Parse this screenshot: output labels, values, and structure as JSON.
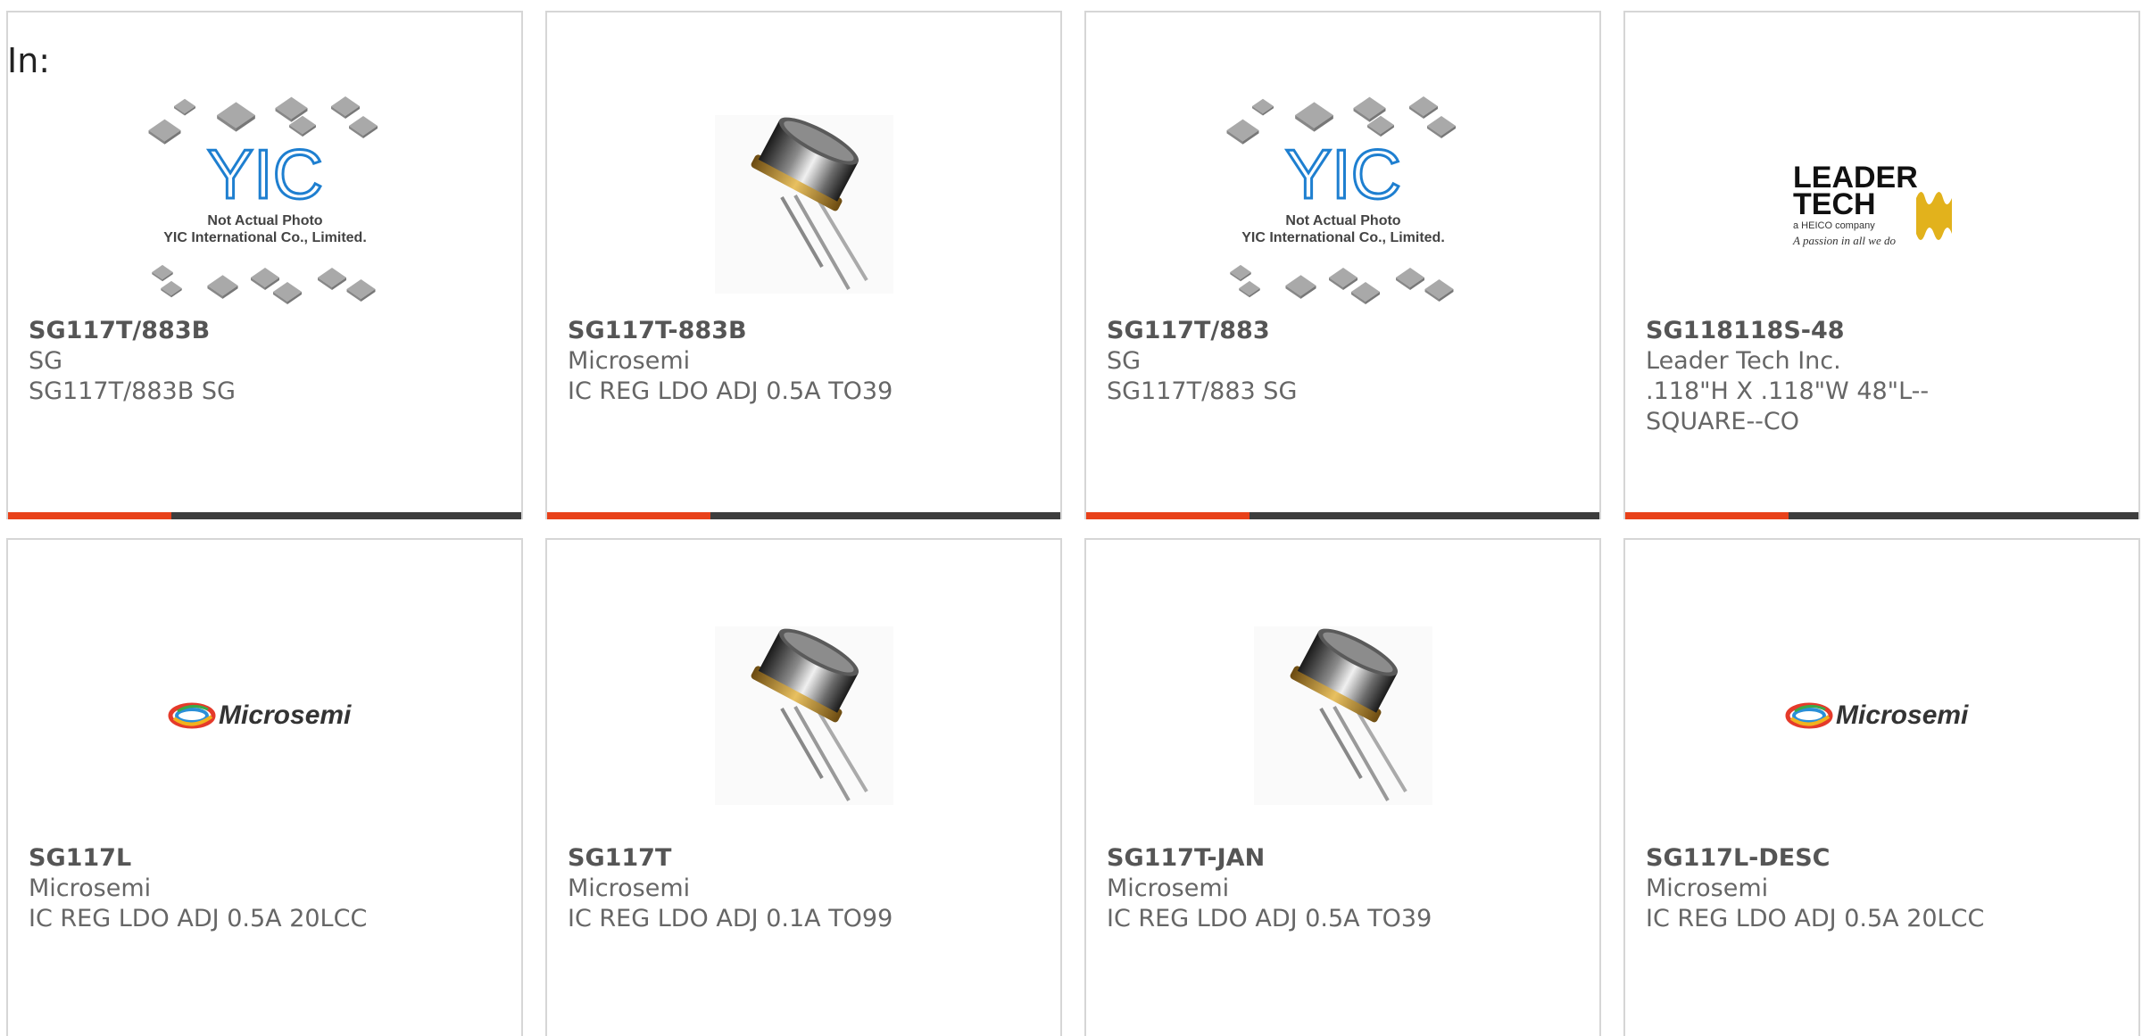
{
  "filter": {
    "label": "In:"
  },
  "products": [
    {
      "part": "SG117T/883B",
      "manufacturer": "SG",
      "description": "SG117T/883B SG",
      "image": "yic-placeholder-photo",
      "placeholder_caption": [
        "Not Actual Photo",
        "YIC International Co., Limited."
      ]
    },
    {
      "part": "SG117T-883B",
      "manufacturer": "Microsemi",
      "description": "IC REG LDO ADJ 0.5A TO39",
      "image": "to-can-transistor-photo"
    },
    {
      "part": "SG117T/883",
      "manufacturer": "SG",
      "description": "SG117T/883 SG",
      "image": "yic-placeholder-photo",
      "placeholder_caption": [
        "Not Actual Photo",
        "YIC International Co., Limited."
      ]
    },
    {
      "part": "SG118118S-48",
      "manufacturer": "Leader Tech Inc.",
      "description": ".118\"H X .118\"W 48\"L--SQUARE--CO",
      "image": "leader-tech-logo",
      "logo_text": [
        "LEADER",
        "TECH",
        "a HEICO company",
        "A passion in all we do"
      ]
    },
    {
      "part": "SG117L",
      "manufacturer": "Microsemi",
      "description": "IC REG LDO ADJ 0.5A 20LCC",
      "image": "microsemi-logo",
      "logo_text": "Microsemi"
    },
    {
      "part": "SG117T",
      "manufacturer": "Microsemi",
      "description": "IC REG LDO ADJ 0.1A TO99",
      "image": "to-can-transistor-photo"
    },
    {
      "part": "SG117T-JAN",
      "manufacturer": "Microsemi",
      "description": "IC REG LDO ADJ 0.5A TO39",
      "image": "to-can-transistor-photo"
    },
    {
      "part": "SG117L-DESC",
      "manufacturer": "Microsemi",
      "description": "IC REG LDO ADJ 0.5A 20LCC",
      "image": "microsemi-logo",
      "logo_text": "Microsemi"
    }
  ],
  "colors": {
    "accent": "#e8411a",
    "bar": "#3d3d3d",
    "border": "#d6d6d6",
    "yic_blue": "#1e7fd0",
    "leader_gold": "#e2b21c"
  }
}
